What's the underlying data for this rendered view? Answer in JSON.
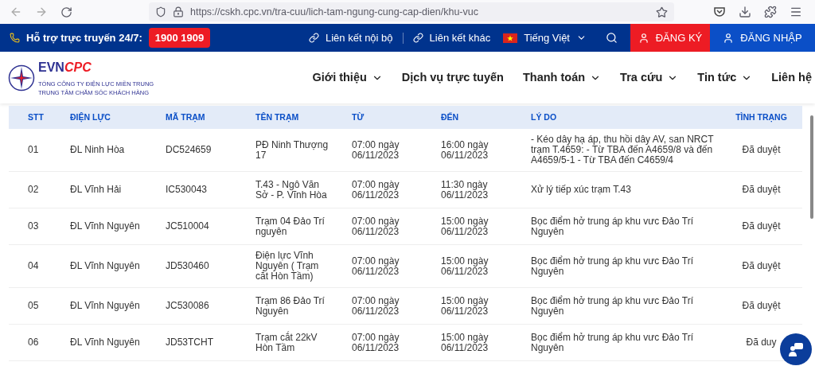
{
  "browser": {
    "url": "https://cskh.cpc.vn/tra-cuu/lich-tam-ngung-cung-cap-dien/khu-vuc"
  },
  "topbar": {
    "hotline_label": "Hỗ trợ trực truyến 24/7:",
    "hotline_number": "1900 1909",
    "links": [
      "Liên kết nội bộ",
      "Liên kết khác"
    ],
    "language": "Tiếng Việt",
    "register": "ĐĂNG KÝ",
    "login": "ĐĂNG NHẬP"
  },
  "header": {
    "logo": {
      "brand": "EVN",
      "brand_accent": "CPC",
      "line1": "TỔNG CÔNG TY ĐIỆN LỰC MIỀN TRUNG",
      "line2": "TRUNG TÂM CHĂM SÓC KHÁCH HÀNG"
    },
    "nav": [
      {
        "label": "Giới thiệu",
        "has_dropdown": true
      },
      {
        "label": "Dịch vụ trực tuyến",
        "has_dropdown": false
      },
      {
        "label": "Thanh toán",
        "has_dropdown": true
      },
      {
        "label": "Tra cứu",
        "has_dropdown": true
      },
      {
        "label": "Tin tức",
        "has_dropdown": true
      },
      {
        "label": "Liên hệ",
        "has_dropdown": false
      }
    ]
  },
  "table": {
    "columns": [
      "STT",
      "ĐIỆN LỰC",
      "MÃ TRẠM",
      "TÊN TRẠM",
      "TỪ",
      "ĐẾN",
      "LÝ DO",
      "TÌNH TRẠNG"
    ],
    "rows": [
      [
        "01",
        "ĐL Ninh Hòa",
        "DC524659",
        "PĐ Ninh Thượng 17",
        "07:00 ngày 06/11/2023",
        "16:00 ngày 06/11/2023",
        "- Kéo dây hạ áp, thu hồi dây AV, san NRCT trạm T.4659: - Từ TBA đến A4659/8 và đến A4659/5-1 - Từ TBA đến C4659/4",
        "Đã duyệt"
      ],
      [
        "02",
        "ĐL Vĩnh Hải",
        "IC530043",
        "T.43 - Ngô Văn Sở - P. Vĩnh Hòa",
        "07:00 ngày 06/11/2023",
        "11:30 ngày 06/11/2023",
        "Xử lý tiếp xúc trạm T.43",
        "Đã duyệt"
      ],
      [
        "03",
        "ĐL Vĩnh Nguyên",
        "JC510004",
        "Trạm 04 Đảo Trí nguyên",
        "07:00 ngày 06/11/2023",
        "15:00 ngày 06/11/2023",
        "Bọc điểm hở trung áp khu vưc Đảo Trí Nguyên",
        "Đã duyệt"
      ],
      [
        "04",
        "ĐL Vĩnh Nguyên",
        "JD530460",
        "Điện lực Vĩnh Nguyên ( Trạm cắt Hòn Tầm)",
        "07:00 ngày 06/11/2023",
        "15:00 ngày 06/11/2023",
        "Bọc điểm hở trung áp khu vưc Đảo Trí Nguyên",
        "Đã duyệt"
      ],
      [
        "05",
        "ĐL Vĩnh Nguyên",
        "JC530086",
        "Trạm 86 Đảo Trí Nguyên",
        "07:00 ngày 06/11/2023",
        "15:00 ngày 06/11/2023",
        "Bọc điểm hở trung áp khu vưc Đảo Trí Nguyên",
        "Đã duyệt"
      ],
      [
        "06",
        "ĐL Vĩnh Nguyên",
        "JD53TCHT",
        "Trạm cắt 22kV Hòn Tầm",
        "07:00 ngày 06/11/2023",
        "15:00 ngày 06/11/2023",
        "Bọc điểm hở trung áp khu vưc Đảo Trí Nguyên",
        "Đã duy"
      ]
    ]
  }
}
